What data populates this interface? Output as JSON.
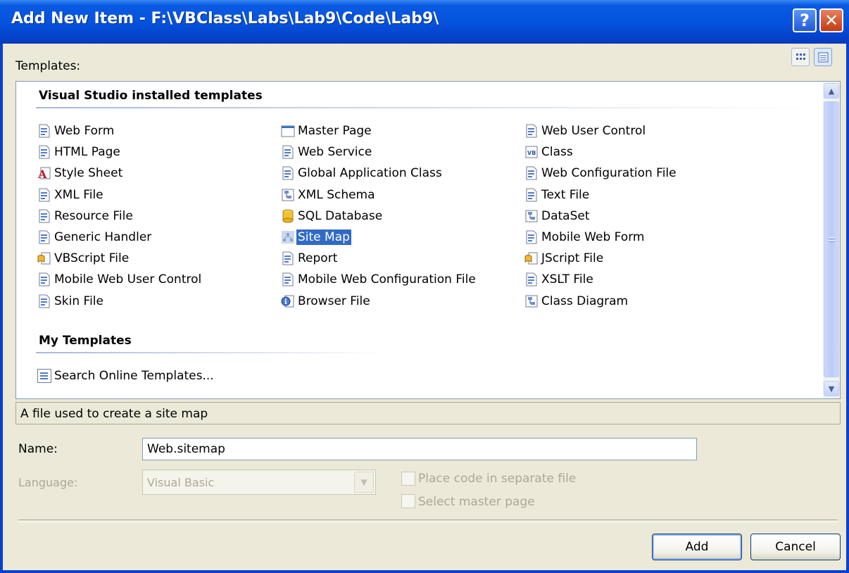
{
  "window": {
    "title": "Add New Item - F:\\VBClass\\Labs\\Lab9\\Code\\Lab9\\",
    "help_glyph": "?",
    "close_glyph": "✕"
  },
  "templates_label": "Templates:",
  "sections": {
    "installed": "Visual Studio installed templates",
    "my": "My Templates"
  },
  "columns": [
    [
      {
        "label": "Web Form",
        "icon": "web-form-icon"
      },
      {
        "label": "HTML Page",
        "icon": "html-page-icon"
      },
      {
        "label": "Style Sheet",
        "icon": "style-sheet-icon"
      },
      {
        "label": "XML File",
        "icon": "xml-file-icon"
      },
      {
        "label": "Resource File",
        "icon": "resource-file-icon"
      },
      {
        "label": "Generic Handler",
        "icon": "generic-handler-icon"
      },
      {
        "label": "VBScript File",
        "icon": "vbscript-file-icon"
      },
      {
        "label": "Mobile Web User Control",
        "icon": "mobile-user-control-icon"
      },
      {
        "label": "Skin File",
        "icon": "skin-file-icon"
      }
    ],
    [
      {
        "label": "Master Page",
        "icon": "master-page-icon"
      },
      {
        "label": "Web Service",
        "icon": "web-service-icon"
      },
      {
        "label": "Global Application Class",
        "icon": "global-app-class-icon"
      },
      {
        "label": "XML Schema",
        "icon": "xml-schema-icon"
      },
      {
        "label": "SQL Database",
        "icon": "sql-database-icon"
      },
      {
        "label": "Site Map",
        "icon": "site-map-icon"
      },
      {
        "label": "Report",
        "icon": "report-icon"
      },
      {
        "label": "Mobile Web Configuration File",
        "icon": "mobile-config-icon"
      },
      {
        "label": "Browser File",
        "icon": "browser-file-icon"
      }
    ],
    [
      {
        "label": "Web User Control",
        "icon": "web-user-control-icon"
      },
      {
        "label": "Class",
        "icon": "class-icon"
      },
      {
        "label": "Web Configuration File",
        "icon": "web-config-icon"
      },
      {
        "label": "Text File",
        "icon": "text-file-icon"
      },
      {
        "label": "DataSet",
        "icon": "dataset-icon"
      },
      {
        "label": "Mobile Web Form",
        "icon": "mobile-web-form-icon"
      },
      {
        "label": "JScript File",
        "icon": "jscript-file-icon"
      },
      {
        "label": "XSLT File",
        "icon": "xslt-file-icon"
      },
      {
        "label": "Class Diagram",
        "icon": "class-diagram-icon"
      }
    ]
  ],
  "selected_item": "Site Map",
  "my_templates": [
    {
      "label": "Search Online Templates...",
      "icon": "search-online-icon"
    }
  ],
  "description": "A file used to create a site map",
  "form": {
    "name_label": "Name:",
    "name_value": "Web.sitemap",
    "language_label": "Language:",
    "language_value": "Visual Basic",
    "place_code_label": "Place code in separate file",
    "select_master_label": "Select master page"
  },
  "buttons": {
    "add": "Add",
    "cancel": "Cancel"
  },
  "colors": {
    "titlebar": "#0553de",
    "selection": "#316ac5",
    "dialog_bg": "#ece9d8"
  }
}
